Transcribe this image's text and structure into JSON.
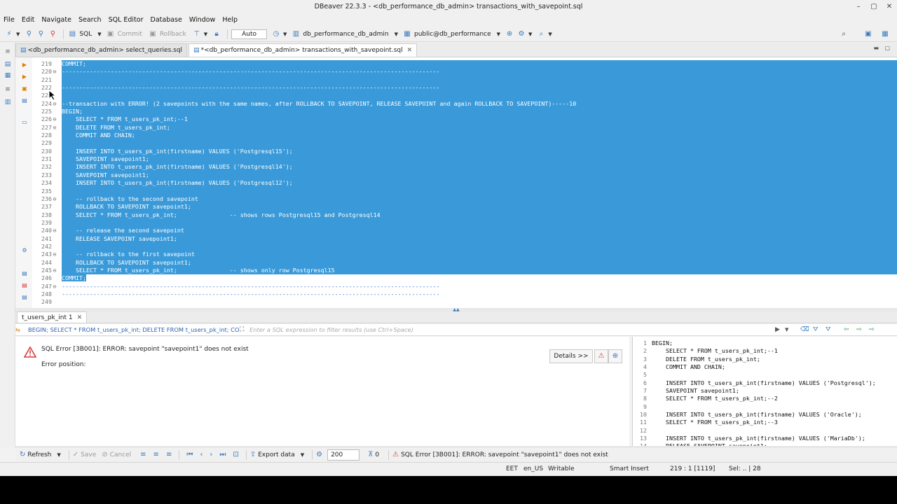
{
  "window": {
    "title": "DBeaver 22.3.3 - <db_performance_db_admin> transactions_with_savepoint.sql",
    "controls": [
      "–",
      "▢",
      "✕"
    ]
  },
  "menu": [
    "File",
    "Edit",
    "Navigate",
    "Search",
    "SQL Editor",
    "Database",
    "Window",
    "Help"
  ],
  "toolbar": {
    "sql_label": "SQL",
    "commit_label": "Commit",
    "rollback_label": "Rollback",
    "mode_label": "Auto",
    "datasource": "db_performance_db_admin",
    "schema": "public@db_performance"
  },
  "editor_tabs": [
    {
      "label": "<db_performance_db_admin> select_queries.sql",
      "active": false
    },
    {
      "label": "*<db_performance_db_admin> transactions_with_savepoint.sql",
      "active": true
    }
  ],
  "editor": {
    "lines": [
      {
        "n": "219",
        "fold": "",
        "text": "COMMIT;",
        "sel": "full"
      },
      {
        "n": "220",
        "fold": "⊖",
        "text": "------------------------------------------------------------------------------------------------------------",
        "sel": "full"
      },
      {
        "n": "221",
        "fold": "",
        "text": "",
        "sel": "full"
      },
      {
        "n": "222",
        "fold": "",
        "text": "------------------------------------------------------------------------------------------------------------",
        "sel": "full"
      },
      {
        "n": "223",
        "fold": "",
        "text": "",
        "sel": "full"
      },
      {
        "n": "224",
        "fold": "⊖",
        "text": "--transaction with ERROR! (2 savepoints with the same names, after ROLLBACK TO SAVEPOINT, RELEASE SAVEPOINT and again ROLLBACK TO SAVEPOINT)-----10",
        "sel": "full"
      },
      {
        "n": "225",
        "fold": "",
        "text": "BEGIN;",
        "sel": "full"
      },
      {
        "n": "226",
        "fold": "⊖",
        "text": "    SELECT * FROM t_users_pk_int;--1",
        "sel": "full"
      },
      {
        "n": "227",
        "fold": "⊖",
        "text": "    DELETE FROM t_users_pk_int;",
        "sel": "full"
      },
      {
        "n": "228",
        "fold": "",
        "text": "    COMMIT AND CHAIN;",
        "sel": "full"
      },
      {
        "n": "229",
        "fold": "",
        "text": "",
        "sel": "full"
      },
      {
        "n": "230",
        "fold": "",
        "text": "    INSERT INTO t_users_pk_int(firstname) VALUES ('Postgresql15');",
        "sel": "full"
      },
      {
        "n": "231",
        "fold": "",
        "text": "    SAVEPOINT savepoint1;",
        "sel": "full"
      },
      {
        "n": "232",
        "fold": "",
        "text": "    INSERT INTO t_users_pk_int(firstname) VALUES ('Postgresql14');",
        "sel": "full"
      },
      {
        "n": "233",
        "fold": "",
        "text": "    SAVEPOINT savepoint1;",
        "sel": "full"
      },
      {
        "n": "234",
        "fold": "",
        "text": "    INSERT INTO t_users_pk_int(firstname) VALUES ('Postgresql12');",
        "sel": "full"
      },
      {
        "n": "235",
        "fold": "",
        "text": "",
        "sel": "full"
      },
      {
        "n": "236",
        "fold": "⊖",
        "text": "    -- rollback to the second savepoint",
        "sel": "full"
      },
      {
        "n": "237",
        "fold": "",
        "text": "    ROLLBACK TO SAVEPOINT savepoint1;",
        "sel": "full"
      },
      {
        "n": "238",
        "fold": "",
        "text": "    SELECT * FROM t_users_pk_int;               -- shows rows Postgresql15 and Postgresql14",
        "sel": "full"
      },
      {
        "n": "239",
        "fold": "",
        "text": "",
        "sel": "full"
      },
      {
        "n": "240",
        "fold": "⊖",
        "text": "    -- release the second savepoint",
        "sel": "full"
      },
      {
        "n": "241",
        "fold": "",
        "text": "    RELEASE SAVEPOINT savepoint1;",
        "sel": "full"
      },
      {
        "n": "242",
        "fold": "",
        "text": "",
        "sel": "full"
      },
      {
        "n": "243",
        "fold": "⊖",
        "text": "    -- rollback to the first savepoint",
        "sel": "full"
      },
      {
        "n": "244",
        "fold": "",
        "text": "    ROLLBACK TO SAVEPOINT savepoint1;",
        "sel": "full"
      },
      {
        "n": "245",
        "fold": "⊖",
        "text": "    SELECT * FROM t_users_pk_int;               -- shows only row Postgresql15",
        "sel": "full"
      },
      {
        "n": "246",
        "fold": "",
        "text": "COMMIT;",
        "sel": "partial"
      },
      {
        "n": "247",
        "fold": "⊖",
        "text": "------------------------------------------------------------------------------------------------------------",
        "sel": "none"
      },
      {
        "n": "248",
        "fold": "",
        "text": "------------------------------------------------------------------------------------------------------------",
        "sel": "none"
      },
      {
        "n": "249",
        "fold": "",
        "text": "",
        "sel": "none"
      }
    ]
  },
  "results": {
    "tab_label": "t_users_pk_int 1",
    "query_text": "BEGIN; SELECT * FROM t_users_pk_int; DELETE FROM t_users_pk_int; CO",
    "filter_placeholder": "Enter a SQL expression to filter results (use Ctrl+Space)",
    "error_message": "SQL Error [3B001]: ERROR: savepoint \"savepoint1\" does not exist",
    "error_position": "Error position:",
    "details_label": "Details >>"
  },
  "sql_panel": {
    "lines": [
      {
        "n": "1",
        "text": "BEGIN;"
      },
      {
        "n": "2",
        "text": "    SELECT * FROM t_users_pk_int;--1"
      },
      {
        "n": "3",
        "text": "    DELETE FROM t_users_pk_int;"
      },
      {
        "n": "4",
        "text": "    COMMIT AND CHAIN;"
      },
      {
        "n": "5",
        "text": ""
      },
      {
        "n": "6",
        "text": "    INSERT INTO t_users_pk_int(firstname) VALUES ('Postgresql');"
      },
      {
        "n": "7",
        "text": "    SAVEPOINT savepoint1;"
      },
      {
        "n": "8",
        "text": "    SELECT * FROM t_users_pk_int;--2"
      },
      {
        "n": "9",
        "text": ""
      },
      {
        "n": "10",
        "text": "    INSERT INTO t_users_pk_int(firstname) VALUES ('Oracle');"
      },
      {
        "n": "11",
        "text": "    SELECT * FROM t_users_pk_int;--3"
      },
      {
        "n": "12",
        "text": ""
      },
      {
        "n": "13",
        "text": "    INSERT INTO t_users_pk_int(firstname) VALUES ('MariaDb');"
      },
      {
        "n": "14",
        "text": "    RELEASE SAVEPOINT savepoint1;"
      }
    ]
  },
  "result_toolbar": {
    "refresh_label": "Refresh",
    "save_label": "Save",
    "cancel_label": "Cancel",
    "export_label": "Export data",
    "row_limit": "200",
    "row_count": "0",
    "status_message": "SQL Error [3B001]: ERROR: savepoint \"savepoint1\" does not exist"
  },
  "statusbar": {
    "timezone": "EET",
    "locale": "en_US",
    "mode": "Writable",
    "insert_mode": "Smart Insert",
    "position": "219 : 1 [1119]",
    "selection": "Sel: .. | 28"
  },
  "colors": {
    "selection": "#3a9ad9",
    "accent": "#3a7bbf",
    "error": "#d9383a"
  }
}
